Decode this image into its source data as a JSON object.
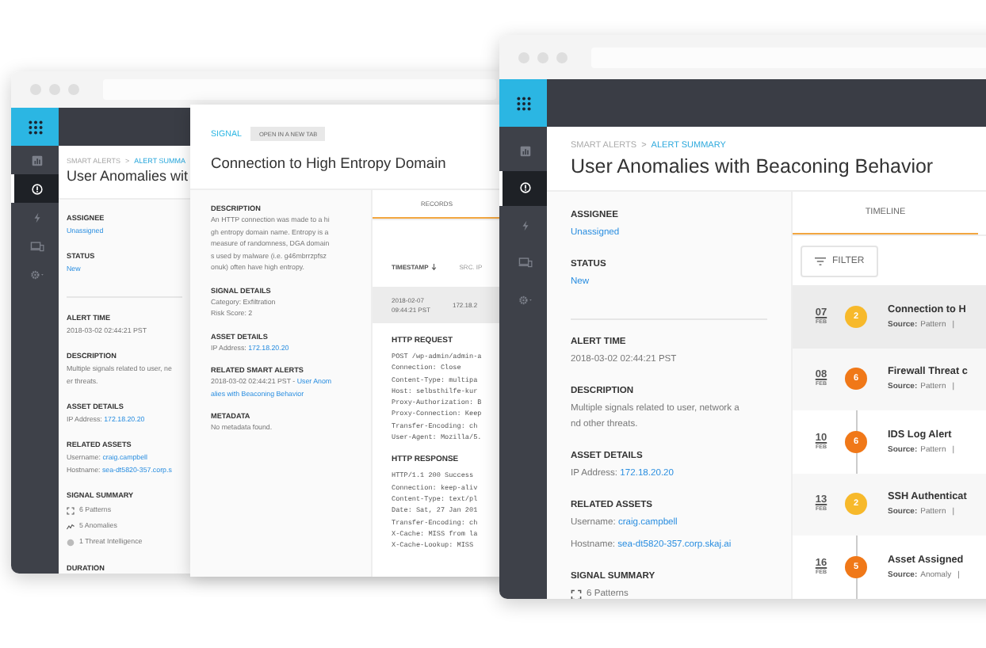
{
  "windows": [
    {
      "nav": [
        {
          "selected": false
        },
        {
          "selected": true
        },
        {
          "selected": false
        },
        {
          "selected": false
        },
        {
          "selected": false
        }
      ],
      "breadcrumb": {
        "parent": "SMART ALERTS",
        "separator": ">",
        "current": "ALERT SUMMA"
      },
      "title": "User Anomalies wit",
      "groups": [
        [
          {
            "label": "ASSIGNEE",
            "kind": "lines",
            "lines": [
              [
                {
                  "text": "Unassigned",
                  "link": true
                }
              ]
            ]
          },
          {
            "label": "STATUS",
            "kind": "lines",
            "lines": [
              [
                {
                  "text": "New",
                  "link": true
                }
              ]
            ]
          }
        ],
        [
          {
            "label": "ALERT TIME",
            "kind": "lines",
            "lines": [
              [
                {
                  "text": "2018-03-02 02:44:21 PST"
                }
              ]
            ]
          },
          {
            "label": "DESCRIPTION",
            "kind": "text",
            "text": [
              "Multiple signals related to user, ne",
              "er threats."
            ]
          },
          {
            "label": "ASSET DETAILS",
            "kind": "lines",
            "lines": [
              [
                {
                  "text": "IP Address: "
                },
                {
                  "text": "172.18.20.20",
                  "link": true
                }
              ]
            ]
          },
          {
            "label": "RELATED ASSETS",
            "kind": "lines",
            "lines": [
              [
                {
                  "text": "Username: "
                },
                {
                  "text": "craig.campbell",
                  "link": true
                }
              ],
              [
                {
                  "text": "Hostname: "
                },
                {
                  "text": "sea-dt5820-357.corp.s",
                  "link": true
                }
              ]
            ]
          },
          {
            "label": "SIGNAL SUMMARY",
            "kind": "summary",
            "items": [
              {
                "kind": "patterns",
                "text": "6 Patterns"
              },
              {
                "kind": "anomalies",
                "text": "5 Anomalies"
              },
              {
                "kind": "threat",
                "text": "1 Threat Intelligence"
              }
            ]
          },
          {
            "label": "DURATION",
            "kind": "label"
          }
        ]
      ]
    },
    {
      "nav": [
        {
          "selected": false
        },
        {
          "selected": true
        },
        {
          "selected": false
        },
        {
          "selected": false
        },
        {
          "selected": false
        }
      ],
      "breadcrumb": {
        "parent": "SMART ALERTS",
        "separator": ">",
        "current": "ALERT SUMMARY"
      },
      "title": "User Anomalies with Beaconing Behavior",
      "groups": [
        [
          {
            "label": "ASSIGNEE",
            "kind": "lines",
            "lines": [
              [
                {
                  "text": "Unassigned",
                  "link": true
                }
              ]
            ]
          },
          {
            "label": "STATUS",
            "kind": "lines",
            "lines": [
              [
                {
                  "text": "New",
                  "link": true
                }
              ]
            ]
          }
        ],
        [
          {
            "label": "ALERT TIME",
            "kind": "lines",
            "lines": [
              [
                {
                  "text": "2018-03-02 02:44:21 PST"
                }
              ]
            ]
          },
          {
            "label": "DESCRIPTION",
            "kind": "text",
            "text": [
              "Multiple signals related to user, network a",
              "nd other threats."
            ]
          },
          {
            "label": "ASSET DETAILS",
            "kind": "lines",
            "lines": [
              [
                {
                  "text": "IP Address: "
                },
                {
                  "text": "172.18.20.20",
                  "link": true
                }
              ]
            ]
          },
          {
            "label": "RELATED ASSETS",
            "kind": "lines",
            "lines": [
              [
                {
                  "text": "Username: "
                },
                {
                  "text": "craig.campbell",
                  "link": true
                }
              ],
              [
                {
                  "text": "Hostname: "
                },
                {
                  "text": "sea-dt5820-357.corp.skaj.ai",
                  "link": true
                }
              ]
            ]
          },
          {
            "label": "SIGNAL SUMMARY",
            "kind": "summary",
            "items": [
              {
                "kind": "patterns",
                "text": "6 Patterns"
              }
            ]
          }
        ]
      ],
      "timeline": {
        "tabs": [
          {
            "label": "TIMELINE",
            "selected": true
          }
        ],
        "filter_button": "FILTER",
        "events": [
          {
            "day": "07",
            "month": "FEB",
            "count": "2",
            "color": "#f7b92b",
            "title": "Connection to H",
            "source_label": "Source:",
            "source": "Pattern",
            "separator": "|",
            "selected": true
          },
          {
            "day": "08",
            "month": "FEB",
            "count": "6",
            "color": "#f07818",
            "title": "Firewall Threat c",
            "source_label": "Source:",
            "source": "Pattern",
            "separator": "|",
            "selected": false
          },
          {
            "day": "10",
            "month": "FEB",
            "count": "6",
            "color": "#f07818",
            "title": "IDS Log Alert",
            "source_label": "Source:",
            "source": "Pattern",
            "separator": "|",
            "selected": false
          },
          {
            "day": "13",
            "month": "FEB",
            "count": "2",
            "color": "#f7b92b",
            "title": "SSH Authenticat",
            "source_label": "Source:",
            "source": "Pattern",
            "separator": "|",
            "selected": false
          },
          {
            "day": "16",
            "month": "FEB",
            "count": "5",
            "color": "#f07818",
            "title": "Asset Assigned",
            "source_label": "Source:",
            "source": "Anomaly",
            "separator": "|",
            "selected": false
          }
        ]
      }
    }
  ],
  "signal_panel": {
    "tag": "SIGNAL",
    "open_button": "OPEN IN A NEW TAB",
    "title": "Connection to High Entropy Domain",
    "groups": [
      [
        {
          "label": "DESCRIPTION",
          "kind": "text",
          "text": [
            "An HTTP connection was made to a hi",
            "gh entropy domain name. Entropy is a",
            "measure of randomness, DGA domain",
            "s used by malware (i.e. g46mbrrzpfsz",
            "onuk) often have high entropy."
          ]
        },
        {
          "label": "SIGNAL DETAILS",
          "kind": "lines",
          "lines": [
            [
              {
                "text": "Category: Exfiltration"
              }
            ],
            [
              {
                "text": "Risk Score: 2"
              }
            ]
          ]
        },
        {
          "label": "ASSET DETAILS",
          "kind": "lines",
          "lines": [
            [
              {
                "text": "IP Address: "
              },
              {
                "text": "172.18.20.20",
                "link": true
              }
            ]
          ]
        },
        {
          "label": "RELATED SMART ALERTS",
          "kind": "lines",
          "lines": [
            [
              {
                "text": "2018-03-02 02:44:21 PST - "
              },
              {
                "text": "User Anom",
                "link": true
              }
            ],
            [
              {
                "text": "alies with Beaconing Behavior",
                "link": true
              }
            ]
          ]
        },
        {
          "label": "METADATA",
          "kind": "lines",
          "lines": [
            [
              {
                "text": "No metadata found."
              }
            ]
          ]
        }
      ]
    ],
    "tabs": [
      {
        "label": "RECORDS",
        "selected": true
      }
    ],
    "table": {
      "columns": [
        {
          "label": "TIMESTAMP",
          "sorted": true
        },
        {
          "label": "SRC. IP",
          "sorted": false
        }
      ],
      "rows": [
        {
          "cells": [
            [
              "2018-02-07",
              "09:44:21 PST"
            ],
            [
              "172.18.2"
            ]
          ],
          "selected": true
        }
      ]
    },
    "blocks": [
      {
        "title": "HTTP REQUEST",
        "lines": [
          "POST /wp-admin/admin-a",
          "Connection: Close",
          "Content-Type: multipa",
          "Host: selbsthilfe-kur",
          "Proxy-Authorization: B",
          "Proxy-Connection: Keep",
          "Transfer-Encoding: ch",
          "User-Agent: Mozilla/5."
        ]
      },
      {
        "title": "HTTP RESPONSE",
        "lines": [
          "HTTP/1.1 200 Success",
          "Connection: keep-aliv",
          "Content-Type: text/pl",
          "Date: Sat, 27 Jan 201",
          "Transfer-Encoding: ch",
          "X-Cache: MISS from la",
          "X-Cache-Lookup: MISS"
        ]
      }
    ]
  }
}
